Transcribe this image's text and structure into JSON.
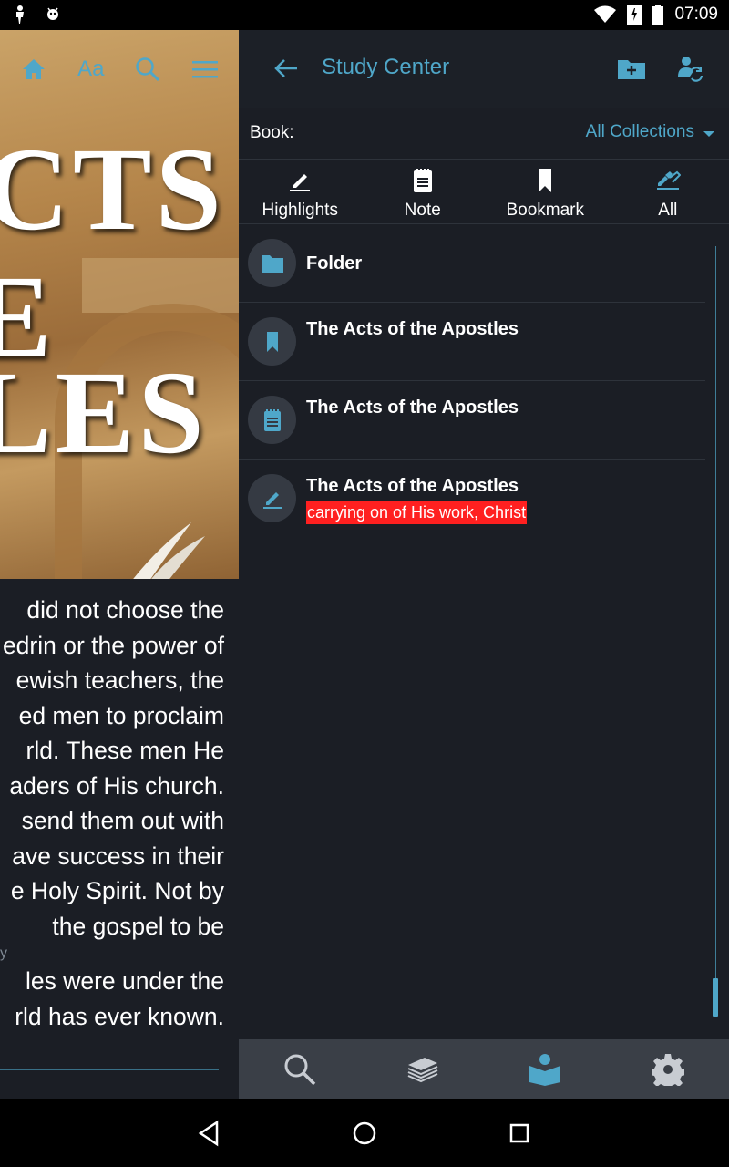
{
  "status_bar": {
    "time": "07:09",
    "icons": [
      "figure-icon",
      "android-icon",
      "wifi-icon",
      "signal-icon",
      "battery-icon"
    ]
  },
  "reader": {
    "toolbar": [
      "home-icon",
      "font-size-icon",
      "search-icon",
      "menu-icon"
    ],
    "font_label": "Aa",
    "cover_text": [
      "CTS",
      "E",
      "LES"
    ],
    "text_lines": [
      "did not choose the",
      "edrin or the power of",
      "ewish teachers, the",
      "ed men to proclaim",
      "rld. These men He",
      "aders of His church.",
      "send them out with",
      "ave success in their",
      "e Holy Spirit. Not by",
      "the gospel to be",
      "y",
      "les were under the",
      "rld has ever known."
    ]
  },
  "study_center": {
    "title": "Study Center",
    "book_label": "Book:",
    "collection_value": "All Collections",
    "tabs": [
      {
        "label": "Highlights",
        "icon": "highlighter-icon"
      },
      {
        "label": "Note",
        "icon": "note-icon"
      },
      {
        "label": "Bookmark",
        "icon": "bookmark-icon"
      },
      {
        "label": "All",
        "icon": "all-icon"
      }
    ],
    "items": [
      {
        "title": "Folder",
        "icon": "folder-icon",
        "highlight": ""
      },
      {
        "title": "The Acts of the Apostles",
        "icon": "bookmark-icon",
        "highlight": ""
      },
      {
        "title": "The Acts of the Apostles",
        "icon": "note-icon",
        "highlight": ""
      },
      {
        "title": "The Acts of the Apostles",
        "icon": "highlighter-icon",
        "highlight": "carrying on of His work, Christ"
      }
    ],
    "bottom_nav": [
      "search-icon",
      "library-icon",
      "study-center-icon",
      "settings-icon"
    ]
  },
  "colors": {
    "accent": "#4fa7c9",
    "background": "#1b1e25",
    "highlight": "#ff2020",
    "bottom_nav": "#3a3f47"
  }
}
